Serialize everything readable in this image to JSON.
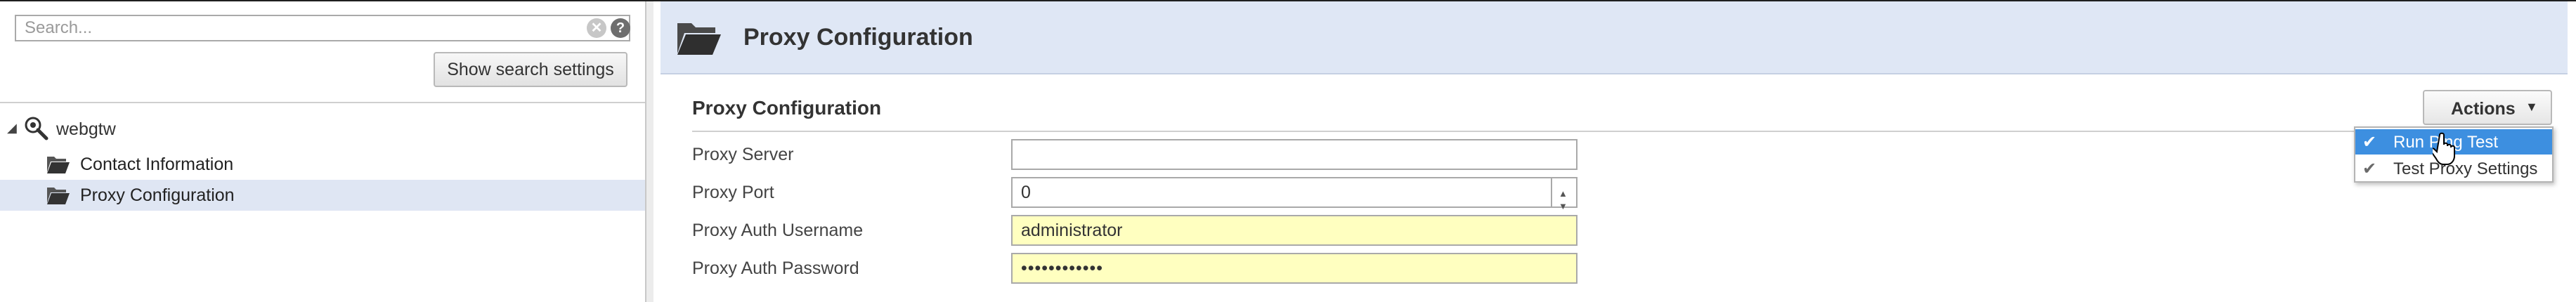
{
  "search": {
    "placeholder": "Search...",
    "clear_symbol": "✕",
    "help_symbol": "?"
  },
  "left": {
    "show_search_settings": "Show search settings"
  },
  "tree": {
    "expander": "◢",
    "root_label": "webgtw",
    "items": [
      {
        "label": "Contact Information",
        "selected": false
      },
      {
        "label": "Proxy Configuration",
        "selected": true
      }
    ]
  },
  "header": {
    "title": "Proxy Configuration",
    "icon": "folder-open-icon"
  },
  "section": {
    "title": "Proxy Configuration"
  },
  "actions": {
    "label": "Actions",
    "caret": "▼",
    "menu": [
      {
        "label": "Run Ping Test",
        "check": "✔",
        "highlighted": true
      },
      {
        "label": "Test Proxy Settings",
        "check": "✔",
        "highlighted": false
      }
    ]
  },
  "form": {
    "proxy_server": {
      "label": "Proxy Server",
      "value": ""
    },
    "proxy_port": {
      "label": "Proxy Port",
      "value": "0",
      "up": "▲",
      "down": "▼"
    },
    "proxy_auth_username": {
      "label": "Proxy Auth Username",
      "value": "administrator"
    },
    "proxy_auth_password": {
      "label": "Proxy Auth Password",
      "value": "••••••••••••"
    }
  },
  "colors": {
    "header_band": "#dfe7f5",
    "selected_row": "#dfe6f3",
    "menu_highlight": "#3d8fe0",
    "autofill_yellow": "#ffffc0"
  }
}
